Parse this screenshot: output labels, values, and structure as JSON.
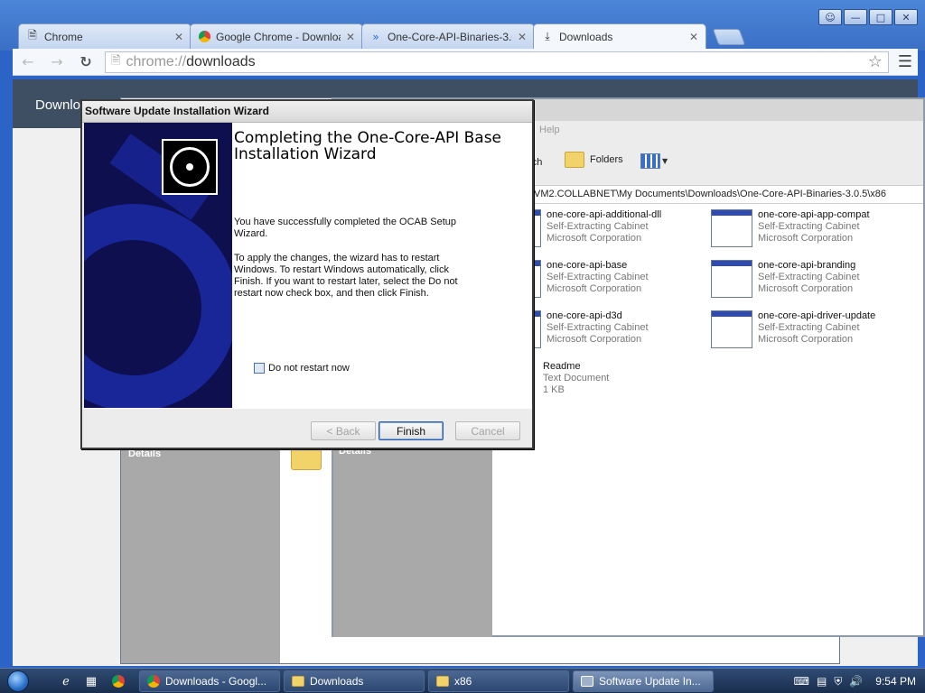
{
  "chrome": {
    "tabs": [
      {
        "title": "Chrome",
        "icon": "page-icon"
      },
      {
        "title": "Google Chrome - Downloa",
        "icon": "chrome-icon"
      },
      {
        "title": "One-Core-API-Binaries-3.0.",
        "icon": "link-icon"
      },
      {
        "title": "Downloads",
        "icon": "download-icon"
      }
    ],
    "address": {
      "scheme": "chrome://",
      "host": "downloads"
    },
    "page_header": "Downlo"
  },
  "explorer": {
    "menu_help": "Help",
    "toolbar": {
      "search": "arch",
      "folders": "Folders"
    },
    "address_path": "VM2.COLLABNET\\My Documents\\Downloads\\One-Core-API-Binaries-3.0.5\\x86",
    "details_label": "Details",
    "files": [
      {
        "name": "one-core-api-additional-dll",
        "type": "Self-Extracting Cabinet",
        "publisher": "Microsoft Corporation"
      },
      {
        "name": "one-core-api-app-compat",
        "type": "Self-Extracting Cabinet",
        "publisher": "Microsoft Corporation"
      },
      {
        "name": "one-core-api-base",
        "type": "Self-Extracting Cabinet",
        "publisher": "Microsoft Corporation"
      },
      {
        "name": "one-core-api-branding",
        "type": "Self-Extracting Cabinet",
        "publisher": "Microsoft Corporation"
      },
      {
        "name": "one-core-api-d3d",
        "type": "Self-Extracting Cabinet",
        "publisher": "Microsoft Corporation"
      },
      {
        "name": "one-core-api-driver-update",
        "type": "Self-Extracting Cabinet",
        "publisher": "Microsoft Corporation"
      },
      {
        "name": "Readme",
        "type": "Text Document",
        "publisher": "1 KB"
      }
    ]
  },
  "explorer_back": {
    "details_label": "Details"
  },
  "wizard": {
    "title": "Software Update Installation Wizard",
    "heading": "Completing the One-Core-API Base Installation Wizard",
    "text1": "You have successfully completed the OCAB Setup Wizard.",
    "text2": "To apply the changes, the wizard has to restart Windows. To restart Windows automatically, click Finish. If you want to restart later, select the Do not restart now check box, and then click Finish.",
    "checkbox_label": "Do not restart now",
    "checkbox_checked": false,
    "buttons": {
      "back": "< Back",
      "finish": "Finish",
      "cancel": "Cancel"
    }
  },
  "taskbar": {
    "tasks": [
      {
        "label": "Downloads - Googl...",
        "icon": "chrome-icon"
      },
      {
        "label": "Downloads",
        "icon": "folder-icon"
      },
      {
        "label": "x86",
        "icon": "folder-icon"
      },
      {
        "label": "Software Update In...",
        "icon": "setup-icon"
      }
    ],
    "clock": "9:54 PM"
  }
}
